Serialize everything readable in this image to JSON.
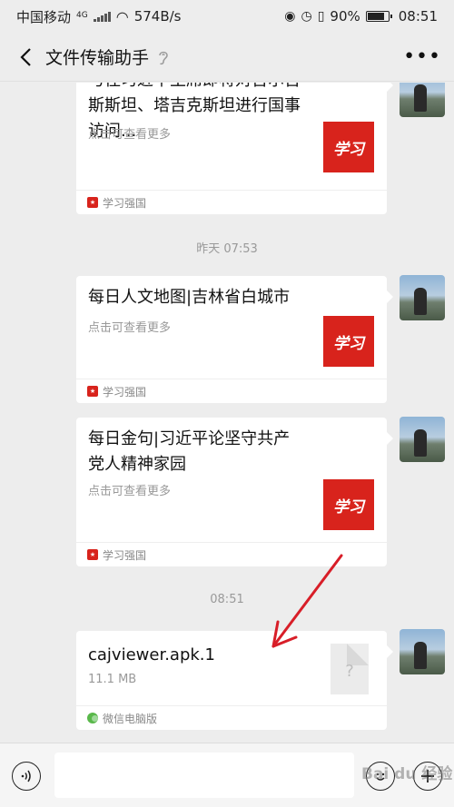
{
  "status_bar": {
    "carrier": "中国移动",
    "network": "4G",
    "speed": "574B/s",
    "battery": "90%",
    "time": "08:51"
  },
  "header": {
    "title": "文件传输助手"
  },
  "messages": [
    {
      "title": "与往习近平主席即将对吉尔吉斯斯坦、塔吉克斯坦进行国事访问...",
      "desc": "点击可查看更多",
      "thumb_text": "学习",
      "source": "学习强国"
    },
    {
      "title": "每日人文地图|吉林省白城市",
      "desc": "点击可查看更多",
      "thumb_text": "学习",
      "source": "学习强国"
    },
    {
      "title": "每日金句|习近平论坚守共产党人精神家园",
      "desc": "点击可查看更多",
      "thumb_text": "学习",
      "source": "学习强国"
    }
  ],
  "timestamps": {
    "yesterday": "昨天 07:53",
    "today": "08:51"
  },
  "file_message": {
    "name": "cajviewer.apk.1",
    "size": "11.1 MB",
    "source": "微信电脑版",
    "file_icon_text": "?"
  },
  "input_bar": {
    "placeholder": ""
  },
  "watermark": "Bai du 经验",
  "colors": {
    "background": "#ededed",
    "card": "#ffffff",
    "brand_red": "#d8231c",
    "arrow": "#d81e28"
  }
}
